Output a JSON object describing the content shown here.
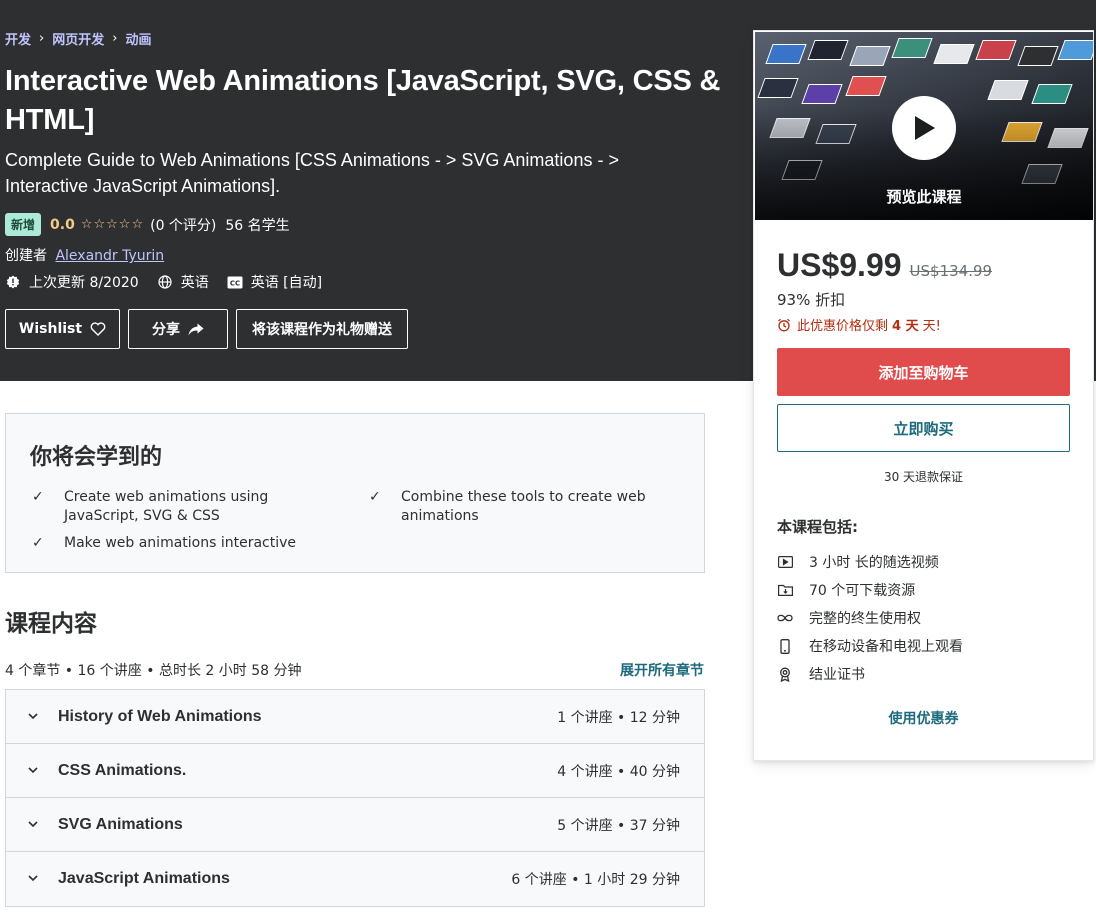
{
  "breadcrumb": [
    "开发",
    "网页开发",
    "动画"
  ],
  "course": {
    "title": "Interactive Web Animations [JavaScript, SVG, CSS & HTML]",
    "subtitle": "Complete Guide to Web Animations [CSS Animations - > SVG Animations - > Interactive JavaScript Animations].",
    "badge": "新增",
    "rating": "0.0",
    "stars": "☆☆☆☆☆",
    "rating_count": "(0 个评分)",
    "students": "56 名学生",
    "creator_label": "创建者",
    "creator_name": "Alexandr Tyurin",
    "last_updated": "上次更新 8/2020",
    "language": "英语",
    "captions": "英语 [自动]"
  },
  "actions": {
    "wishlist": "Wishlist",
    "share": "分享",
    "gift": "将该课程作为礼物赠送"
  },
  "sidebar": {
    "preview_label": "预览此课程",
    "price": "US$9.99",
    "original_price": "US$134.99",
    "discount": "93% 折扣",
    "timer_prefix": "此优惠价格仅剩",
    "timer_days": "4 天",
    "timer_suffix": "天!",
    "add_to_cart": "添加至购物车",
    "buy_now": "立即购买",
    "guarantee": "30 天退款保证",
    "includes_title": "本课程包括:",
    "includes": [
      {
        "icon": "video-icon",
        "text": "3 小时 长的随选视频"
      },
      {
        "icon": "download-file-icon",
        "text": "70 个可下载资源"
      },
      {
        "icon": "infinity-icon",
        "text": "完整的终生使用权"
      },
      {
        "icon": "mobile-icon",
        "text": "在移动设备和电视上观看"
      },
      {
        "icon": "certificate-icon",
        "text": "结业证书"
      }
    ],
    "coupon": "使用优惠券"
  },
  "learn": {
    "title": "你将会学到的",
    "items": [
      "Create web animations using JavaScript, SVG & CSS",
      "Combine these tools to create web animations",
      "Make web animations interactive"
    ]
  },
  "content": {
    "title": "课程内容",
    "meta": "4 个章节 • 16 个讲座 • 总时长 2 小时 58 分钟",
    "expand_all": "展开所有章节",
    "sections": [
      {
        "title": "History of Web Animations",
        "meta": "1 个讲座 • 12 分钟"
      },
      {
        "title": "CSS Animations.",
        "meta": "4 个讲座 • 40 分钟"
      },
      {
        "title": "SVG Animations",
        "meta": "5 个讲座 • 37 分钟"
      },
      {
        "title": "JavaScript Animations",
        "meta": "6 个讲座 • 1 小时 29 分钟"
      }
    ]
  },
  "colors": {
    "header_bg": "#2d2f31",
    "link_purple": "#c0c4fc",
    "cart_red": "#e04b4b",
    "teal": "#1c6a7d",
    "timer_red": "#b32d0f",
    "star_gold": "#f3ca8c",
    "badge_green": "#acead7"
  }
}
